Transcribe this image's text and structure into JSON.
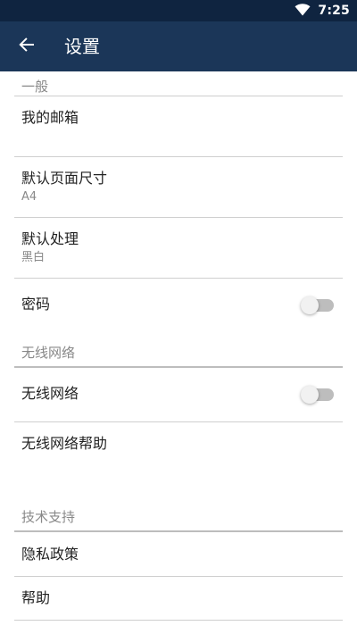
{
  "status_bar": {
    "time": "7:25",
    "wifi_icon": "wifi-icon",
    "battery_icon": "battery-icon"
  },
  "app_bar": {
    "title": "设置",
    "back_icon": "arrow-back-icon"
  },
  "sections": {
    "general": {
      "header": "一般",
      "my_email": {
        "title": "我的邮箱"
      },
      "page_size": {
        "title": "默认页面尺寸",
        "value": "A4"
      },
      "processing": {
        "title": "默认处理",
        "value": "黑白"
      },
      "password": {
        "title": "密码",
        "enabled": false
      }
    },
    "wifi": {
      "header": "无线网络",
      "wifi_toggle": {
        "title": "无线网络",
        "enabled": false
      },
      "wifi_help": {
        "title": "无线网络帮助"
      }
    },
    "support": {
      "header": "技术支持",
      "privacy": {
        "title": "隐私政策"
      },
      "help": {
        "title": "帮助"
      }
    }
  },
  "colors": {
    "status_bar": "#0f2440",
    "app_bar": "#1b3658",
    "switch_track_off": "#bdbdbd",
    "switch_thumb_off": "#f1f1f1"
  }
}
